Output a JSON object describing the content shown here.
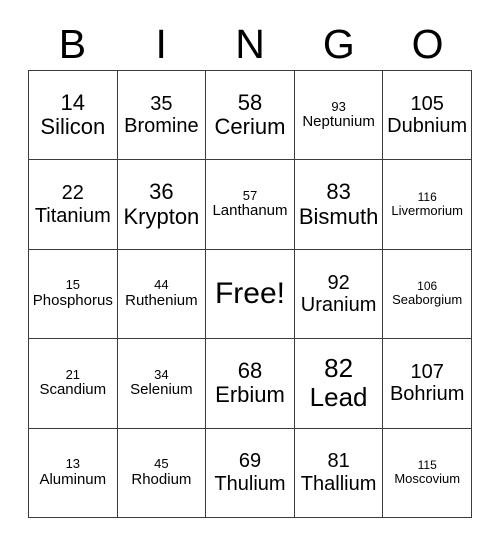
{
  "card": {
    "header_letters": [
      "B",
      "I",
      "N",
      "G",
      "O"
    ],
    "free_space_label": "Free!",
    "colors": {
      "background": "#ffffff",
      "text": "#000000",
      "grid_line": "#3c3c3c"
    },
    "rows": [
      [
        {
          "number": "14",
          "name": "Silicon",
          "size": "lg"
        },
        {
          "number": "35",
          "name": "Bromine",
          "size": "md"
        },
        {
          "number": "58",
          "name": "Cerium",
          "size": "lg"
        },
        {
          "number": "93",
          "name": "Neptunium",
          "size": "xs"
        },
        {
          "number": "105",
          "name": "Dubnium",
          "size": "md"
        }
      ],
      [
        {
          "number": "22",
          "name": "Titanium",
          "size": "md"
        },
        {
          "number": "36",
          "name": "Krypton",
          "size": "lg"
        },
        {
          "number": "57",
          "name": "Lanthanum",
          "size": "xs"
        },
        {
          "number": "83",
          "name": "Bismuth",
          "size": "lg"
        },
        {
          "number": "116",
          "name": "Livermorium",
          "size": "xxs"
        }
      ],
      [
        {
          "number": "15",
          "name": "Phosphorus",
          "size": "xs"
        },
        {
          "number": "44",
          "name": "Ruthenium",
          "size": "xs"
        },
        {
          "free": true,
          "name": "Free!",
          "size": "free"
        },
        {
          "number": "92",
          "name": "Uranium",
          "size": "md"
        },
        {
          "number": "106",
          "name": "Seaborgium",
          "size": "xxs"
        }
      ],
      [
        {
          "number": "21",
          "name": "Scandium",
          "size": "xs"
        },
        {
          "number": "34",
          "name": "Selenium",
          "size": "xs"
        },
        {
          "number": "68",
          "name": "Erbium",
          "size": "lg"
        },
        {
          "number": "82",
          "name": "Lead",
          "size": "xl"
        },
        {
          "number": "107",
          "name": "Bohrium",
          "size": "md"
        }
      ],
      [
        {
          "number": "13",
          "name": "Aluminum",
          "size": "xs"
        },
        {
          "number": "45",
          "name": "Rhodium",
          "size": "xs"
        },
        {
          "number": "69",
          "name": "Thulium",
          "size": "md"
        },
        {
          "number": "81",
          "name": "Thallium",
          "size": "md"
        },
        {
          "number": "115",
          "name": "Moscovium",
          "size": "xxs"
        }
      ]
    ]
  }
}
